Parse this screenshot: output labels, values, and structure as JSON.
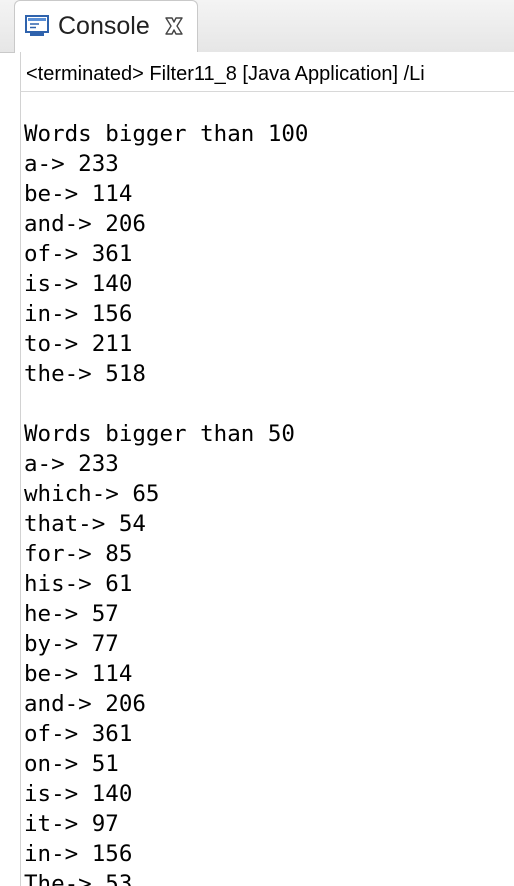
{
  "tab": {
    "icon": "console-icon",
    "title": "Console",
    "close_icon": "close-icon"
  },
  "description": "<terminated> Filter11_8 [Java Application] /Li",
  "console": {
    "lines": [
      "Words bigger than 100",
      "a-> 233",
      "be-> 114",
      "and-> 206",
      "of-> 361",
      "is-> 140",
      "in-> 156",
      "to-> 211",
      "the-> 518",
      "",
      "Words bigger than 50",
      "a-> 233",
      "which-> 65",
      "that-> 54",
      "for-> 85",
      "his-> 61",
      "he-> 57",
      "by-> 77",
      "be-> 114",
      "and-> 206",
      "of-> 361",
      "on-> 51",
      "is-> 140",
      "it-> 97",
      "in-> 156",
      "The-> 53"
    ]
  },
  "colors": {
    "tab_background": "#ffffff",
    "tabbar_background": "#e6e6e6",
    "icon_blue": "#3a6fb4",
    "text": "#000000"
  }
}
